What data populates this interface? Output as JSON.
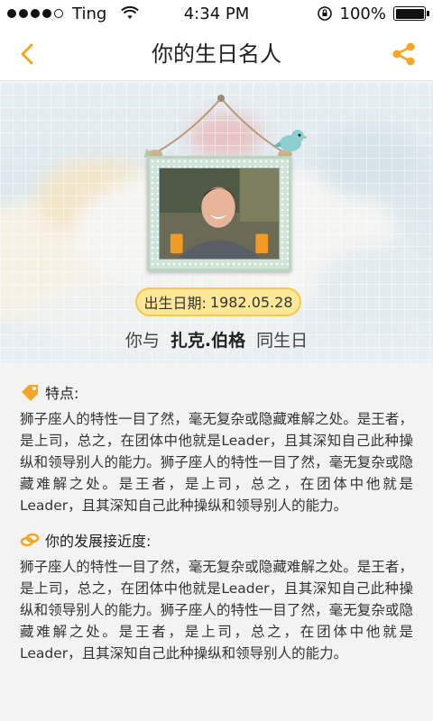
{
  "status_bar": {
    "carrier": "Ting",
    "time": "4:34 PM",
    "battery": "100%",
    "battery_level": 1.0,
    "signal_bars": 4
  },
  "nav": {
    "title": "你的生日名人",
    "back_icon": "chevron-left-icon",
    "share_icon": "share-icon"
  },
  "hero": {
    "birth_date_label": "出生日期:",
    "birth_date": "1982.05.28",
    "same_day_prefix": "你与",
    "celebrity_name": "扎克.伯格",
    "same_day_suffix": "同生日"
  },
  "sections": [
    {
      "title": "特点:",
      "icon": "tag-icon",
      "body": "狮子座人的特性一目了然，毫无复杂或隐藏难解之处。是王者，是上司，总之，在团体中他就是Leader，且其深知自己此种操纵和领导别人的能力。狮子座人的特性一目了然，毫无复杂或隐藏难解之处。是王者，是上司，总之，在团体中他就是Leader，且其深知自己此种操纵和领导别人的能力。"
    },
    {
      "title": "你的发展接近度:",
      "icon": "link-icon",
      "body": "狮子座人的特性一目了然，毫无复杂或隐藏难解之处。是王者，是上司，总之，在团体中他就是Leader，且其深知自己此种操纵和领导别人的能力。狮子座人的特性一目了然，毫无复杂或隐藏难解之处。是王者，是上司，总之，在团体中他就是Leader，且其深知自己此种操纵和领导别人的能力。"
    }
  ],
  "colors": {
    "accent": "#f5a623",
    "badge_fill": "#ffe79a",
    "badge_border": "#f4c94c"
  }
}
